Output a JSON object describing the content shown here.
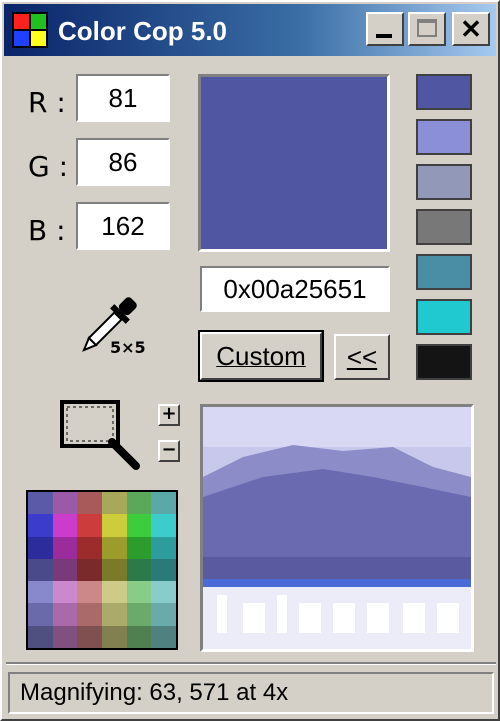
{
  "window": {
    "title": "Color Cop 5.0",
    "controls": {
      "minimize": "_",
      "maximize": "□",
      "close": "✕"
    }
  },
  "rgb": {
    "r_label": "R :",
    "r_value": "81",
    "g_label": "G :",
    "g_value": "86",
    "b_label": "B :",
    "b_value": "162"
  },
  "hex": {
    "value": "0x00a25651"
  },
  "current_color": "#5156a2",
  "history": [
    "#5156a2",
    "#8a8fd8",
    "#9198b8",
    "#787878",
    "#4a8ea6",
    "#20c8d0",
    "#141414"
  ],
  "eyedropper": {
    "label": "5×5",
    "icon": "eyedropper-icon"
  },
  "buttons": {
    "custom": "Custom",
    "back": "<<"
  },
  "zoom": {
    "plus": "+",
    "minus": "−",
    "icon": "magnifier-icon"
  },
  "palette_colors": [
    [
      "#5a5aa8",
      "#9a5aa8",
      "#a85a5a",
      "#a8a85a",
      "#5aa85a",
      "#5aa8a8"
    ],
    [
      "#3c3ccc",
      "#cc3ccc",
      "#cc3c3c",
      "#cccc3c",
      "#3ccc3c",
      "#3ccccc"
    ],
    [
      "#2c2c9c",
      "#9c2c9c",
      "#9c2c2c",
      "#9c9c2c",
      "#2c9c2c",
      "#2c9c9c"
    ],
    [
      "#4a4a8a",
      "#7a3a7a",
      "#7a2a2a",
      "#7a7a2a",
      "#2a7a4a",
      "#2a7a7a"
    ],
    [
      "#8888cc",
      "#cc88cc",
      "#cc8888",
      "#cccc88",
      "#88cc88",
      "#88cccc"
    ],
    [
      "#6a6aaa",
      "#aa6aaa",
      "#aa6a6a",
      "#aaaa6a",
      "#6aaa6a",
      "#6aaaaa"
    ],
    [
      "#505080",
      "#805080",
      "#805050",
      "#808050",
      "#508050",
      "#508080"
    ]
  ],
  "status": {
    "text": "Magnifying: 63, 571 at 4x"
  }
}
